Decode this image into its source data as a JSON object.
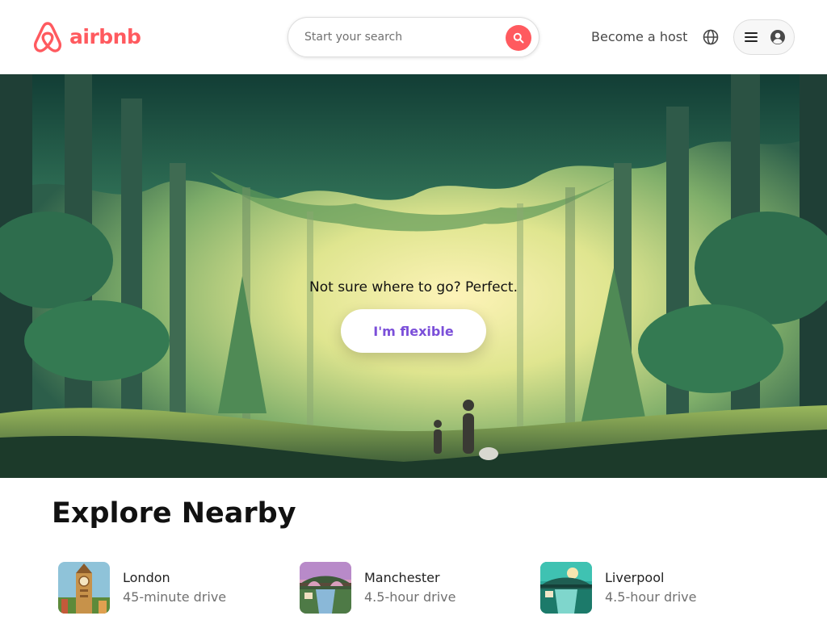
{
  "header": {
    "brand": "airbnb",
    "search_placeholder": "Start your search",
    "become_host": "Become a host"
  },
  "icons": {
    "logo": "airbnb-logo-icon",
    "search": "search-icon",
    "globe": "globe-icon",
    "menu": "hamburger-menu-icon",
    "user": "user-avatar-icon"
  },
  "hero": {
    "tagline": "Not sure where to go? Perfect.",
    "button_label": "I'm flexible"
  },
  "explore": {
    "title": "Explore Nearby",
    "items": [
      {
        "name": "London",
        "drive": "45-minute drive"
      },
      {
        "name": "Manchester",
        "drive": "4.5-hour drive"
      },
      {
        "name": "Liverpool",
        "drive": "4.5-hour drive"
      }
    ]
  },
  "colors": {
    "brand": "#FF5A5F",
    "flexible_text": "#7B4FD9",
    "secondary_text": "#717171"
  }
}
